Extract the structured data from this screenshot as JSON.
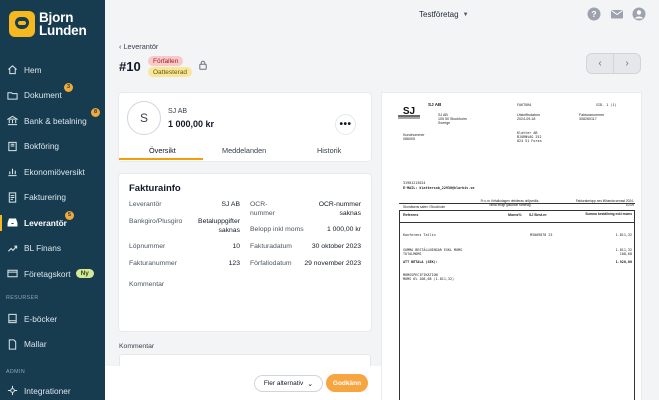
{
  "brand": {
    "name_line1": "Bjorn",
    "name_line2": "Lunden"
  },
  "sidebar": {
    "items": [
      {
        "label": "Hem",
        "icon": "home-icon"
      },
      {
        "label": "Dokument",
        "icon": "folder-icon",
        "badge": "3"
      },
      {
        "label": "Bank & betalning",
        "icon": "bank-icon",
        "badge": "8"
      },
      {
        "label": "Bokföring",
        "icon": "book-icon"
      },
      {
        "label": "Ekonomiöversikt",
        "icon": "chart-icon"
      },
      {
        "label": "Fakturering",
        "icon": "invoice-icon"
      },
      {
        "label": "Leverantör",
        "icon": "inbox-icon",
        "badge": "5",
        "active": true
      },
      {
        "label": "BL Finans",
        "icon": "finance-icon"
      },
      {
        "label": "Företagskort",
        "icon": "card-icon",
        "pill": "Ny"
      }
    ],
    "section_resurser": "RESURSER",
    "resurser_items": [
      {
        "label": "E-böcker",
        "icon": "ebook-icon"
      },
      {
        "label": "Mallar",
        "icon": "template-icon"
      }
    ],
    "section_admin": "ADMIN",
    "admin_items": [
      {
        "label": "Integrationer",
        "icon": "integration-icon"
      }
    ]
  },
  "topbar": {
    "company": "Testföretag",
    "icons": [
      "help-icon",
      "mail-icon",
      "user-icon"
    ]
  },
  "header": {
    "back_label": "Leverantör",
    "title": "#10",
    "badge_overdue": "Förfallen",
    "badge_unapproved": "Oattesterad"
  },
  "supplier": {
    "avatar_letter": "S",
    "name": "SJ AB",
    "amount": "1 000,00 kr",
    "more": "•••",
    "tabs": [
      "Översikt",
      "Meddelanden",
      "Historik"
    ]
  },
  "invoice_info": {
    "title": "Fakturainfo",
    "left": [
      {
        "label": "Leverantör",
        "value": "SJ AB"
      },
      {
        "label": "Bankgiro/Plusgiro",
        "value": "Betaluppgifter saknas"
      },
      {
        "label": "Löpnummer",
        "value": "10"
      },
      {
        "label": "Fakturanummer",
        "value": "123"
      },
      {
        "label": "Kommentar",
        "value": ""
      }
    ],
    "right": [
      {
        "label": "OCR-nummer",
        "value": "OCR-nummer saknas"
      },
      {
        "label": "Belopp inkl moms",
        "value": "1 000,00 kr"
      },
      {
        "label": "Fakturadatum",
        "value": "30 oktober 2023"
      },
      {
        "label": "Förfallodatum",
        "value": "29 november 2023"
      }
    ]
  },
  "comment": {
    "label": "Kommentar",
    "placeholder": ""
  },
  "actions": {
    "more_label": "Fler alternativ",
    "approve_label": "Godkänn"
  },
  "preview": {
    "company": "SJ AB",
    "address": [
      "SJ AB",
      "105 50 Stockholm",
      "Sverige"
    ],
    "doc_type": "FAKTURA",
    "page": "SID. 1 (1)",
    "invoice_date_label": "Utskriftsdatum",
    "invoice_date": "2024-09-18",
    "invoice_no_label": "Fakturanummer",
    "invoice_no": "308260117",
    "customer_no_label": "Kundnummer",
    "customer_no": "086005",
    "recipient": [
      "Klatter AB",
      "BJORNVAG 252",
      "824 51 Forsa"
    ],
    "ref": "31901213024",
    "email": "E-MAIL: klattercab_22930@klarbiv.se",
    "bar_left": "Stornäsens salter i Stockholm",
    "bar_mid": "Fr.o.m. förfallodagen debiteras dröjsmåls- ränta enligt gällande räntelag",
    "bar_right": "Fakturabelopp ses tillhanda senast 2024-10-09",
    "col_ref": "Referens",
    "col_moms": "Moms%",
    "col_sj": "SJ Best.nr",
    "col_amount": "Summa beställning exkl moms",
    "rows": [
      {
        "text": "Konferens Tallin",
        "code": "M3009878 23",
        "amount": "1.811,32"
      },
      {
        "text": "SUMMA BESTÄLLNINGAR EXKL MOMS",
        "code": "",
        "amount": "1.811,32"
      },
      {
        "text": "TOTALMOMS",
        "code": "",
        "amount": "108,68"
      }
    ],
    "total_label": "ATT BETALA (SEK):",
    "total": "1.920,00",
    "spec_label": "MOMSSPECIFIKATION",
    "spec_row": "MOMS   6%      108,68    (1.811,32)"
  }
}
